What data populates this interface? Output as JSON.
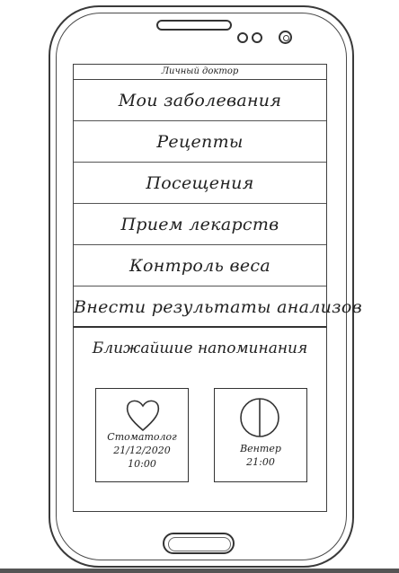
{
  "app": {
    "title": "Личный доктор"
  },
  "menu": {
    "items": [
      {
        "label": "Мои заболевания"
      },
      {
        "label": "Рецепты"
      },
      {
        "label": "Посещения"
      },
      {
        "label": "Прием лекарств"
      },
      {
        "label": "Контроль веса"
      },
      {
        "label": "Внести результаты анализов"
      }
    ]
  },
  "reminders": {
    "title": "Ближайшие напоминания",
    "cards": [
      {
        "icon": "heart-icon",
        "line1": "Стоматолог",
        "line2": "21/12/2020",
        "line3": "10:00"
      },
      {
        "icon": "clock-icon",
        "line1": "Вентер",
        "line2": "21:00"
      }
    ]
  }
}
